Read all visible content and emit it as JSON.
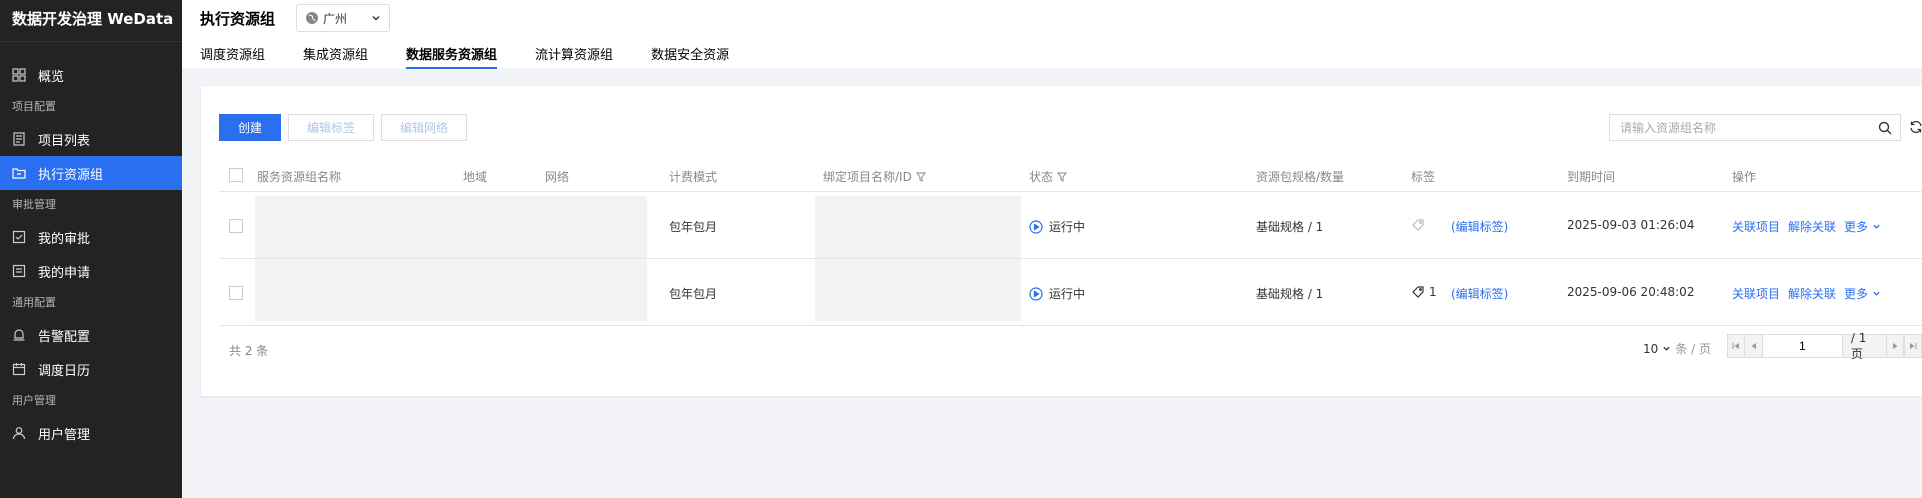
{
  "app": {
    "title": "数据开发治理 WeData"
  },
  "sidebar": {
    "items": [
      {
        "type": "item",
        "label": "概览",
        "icon": "dashboard-icon"
      },
      {
        "type": "group",
        "label": "项目配置"
      },
      {
        "type": "item",
        "label": "项目列表",
        "icon": "list-icon"
      },
      {
        "type": "item",
        "label": "执行资源组",
        "icon": "folder-icon",
        "active": true
      },
      {
        "type": "group",
        "label": "审批管理"
      },
      {
        "type": "item",
        "label": "我的审批",
        "icon": "approval-icon"
      },
      {
        "type": "item",
        "label": "我的申请",
        "icon": "application-icon"
      },
      {
        "type": "group",
        "label": "通用配置"
      },
      {
        "type": "item",
        "label": "告警配置",
        "icon": "bell-icon"
      },
      {
        "type": "item",
        "label": "调度日历",
        "icon": "calendar-icon"
      },
      {
        "type": "group",
        "label": "用户管理"
      },
      {
        "type": "item",
        "label": "用户管理",
        "icon": "user-icon"
      }
    ]
  },
  "header": {
    "title": "执行资源组",
    "region": "广州",
    "tabs": [
      {
        "label": "调度资源组"
      },
      {
        "label": "集成资源组"
      },
      {
        "label": "数据服务资源组",
        "active": true
      },
      {
        "label": "流计算资源组"
      },
      {
        "label": "数据安全资源"
      }
    ]
  },
  "toolbar": {
    "create": "创建",
    "edit_tags": "编辑标签",
    "edit_network": "编辑网络",
    "search_placeholder": "请输入资源组名称"
  },
  "table": {
    "columns": {
      "name": "服务资源组名称",
      "region": "地域",
      "network": "网络",
      "billing": "计费模式",
      "project": "绑定项目名称/ID",
      "status": "状态",
      "spec": "资源包规格/数量",
      "tags": "标签",
      "expiry": "到期时间",
      "ops": "操作"
    },
    "rows": [
      {
        "billing": "包年包月",
        "status": "运行中",
        "spec": "基础规格 / 1",
        "tag_count": "",
        "edit_tag": "(编辑标签)",
        "expiry": "2025-09-03 01:26:04",
        "op_link": "关联项目",
        "op_unlink": "解除关联",
        "op_more": "更多"
      },
      {
        "billing": "包年包月",
        "status": "运行中",
        "spec": "基础规格 / 1",
        "tag_count": "1",
        "edit_tag": "(编辑标签)",
        "expiry": "2025-09-06 20:48:02",
        "op_link": "关联项目",
        "op_unlink": "解除关联",
        "op_more": "更多"
      }
    ]
  },
  "pagination": {
    "total": "共 2 条",
    "page_size": "10",
    "page_size_unit": "条 / 页",
    "current_page": "1",
    "total_pages": "/ 1 页"
  },
  "colors": {
    "accent": "#2a6ff0",
    "sidebar_bg": "#232323"
  }
}
